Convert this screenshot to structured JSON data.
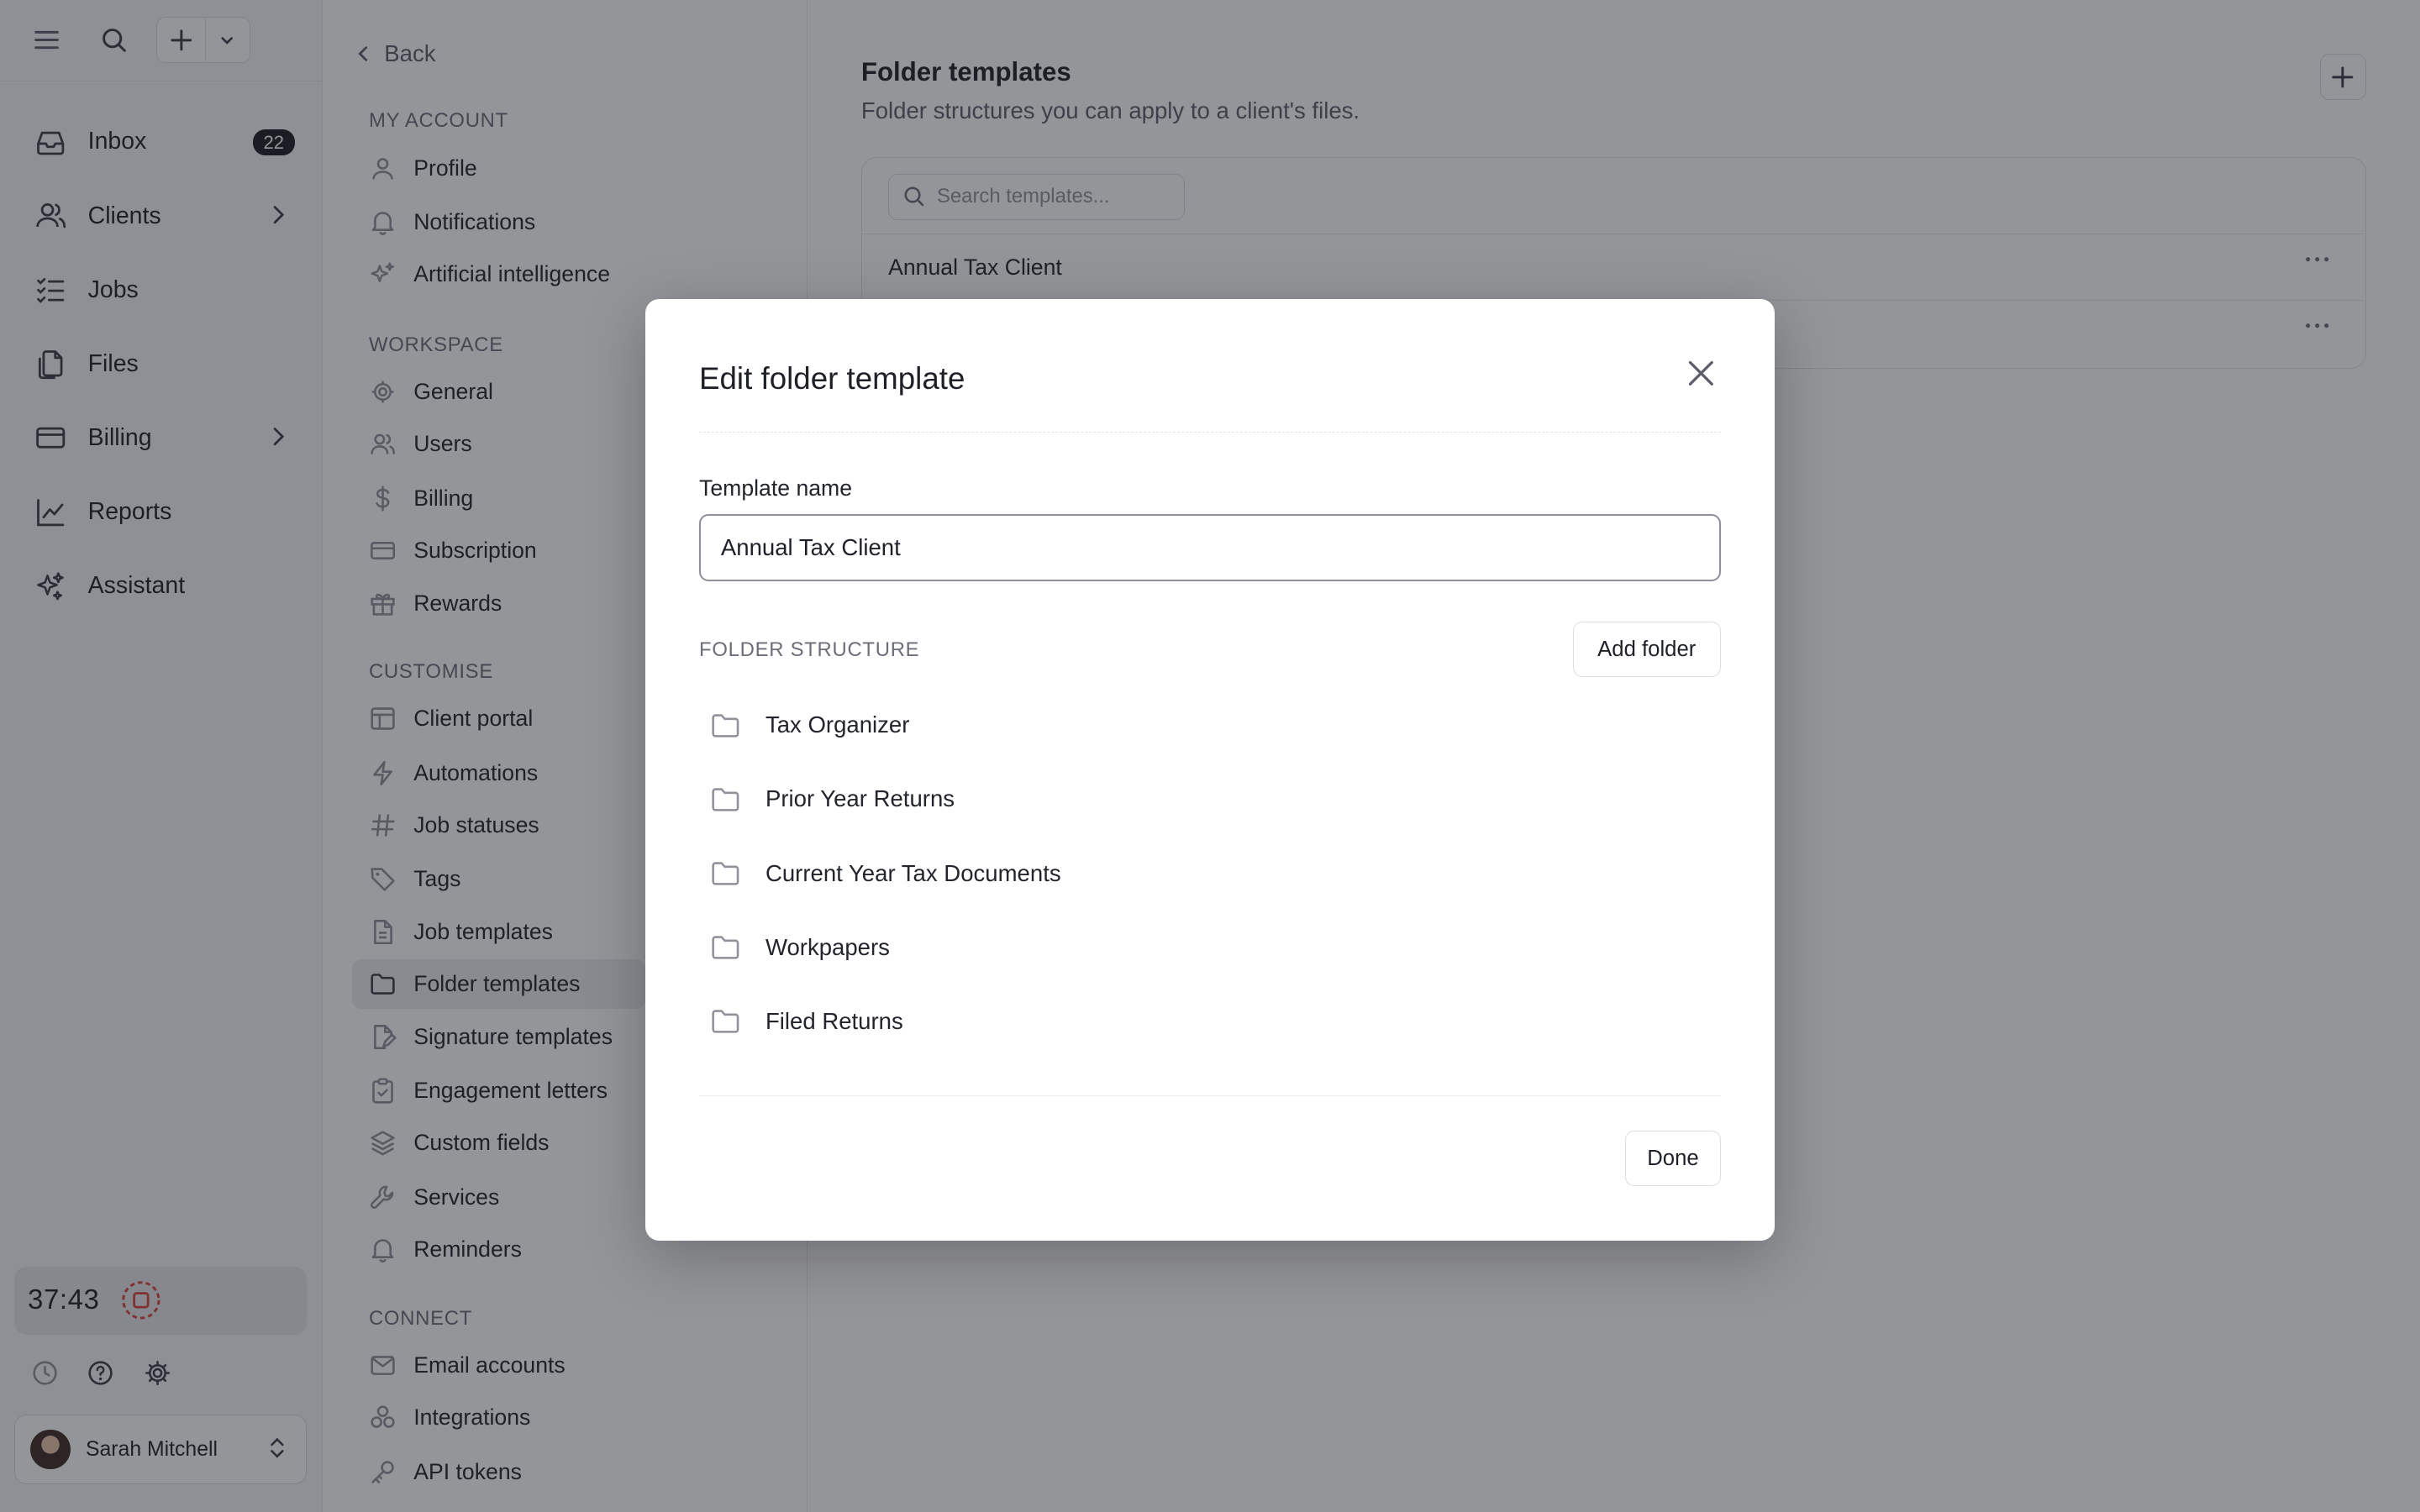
{
  "nav": {
    "items": [
      {
        "label": "Inbox",
        "icon": "inbox-icon",
        "badge": "22"
      },
      {
        "label": "Clients",
        "icon": "users-icon"
      },
      {
        "label": "Jobs",
        "icon": "list-check-icon"
      },
      {
        "label": "Files",
        "icon": "files-icon"
      },
      {
        "label": "Billing",
        "icon": "credit-card-icon"
      },
      {
        "label": "Reports",
        "icon": "chart-line-icon"
      },
      {
        "label": "Assistant",
        "icon": "sparkles-icon"
      }
    ],
    "timer": "37:43",
    "user_name": "Sarah Mitchell"
  },
  "settings": {
    "back_label": "Back",
    "sections": {
      "my_account": "MY ACCOUNT",
      "workspace": "WORKSPACE",
      "customise": "CUSTOMISE",
      "connect": "CONNECT"
    },
    "items": {
      "profile": "Profile",
      "notifications": "Notifications",
      "ai": "Artificial intelligence",
      "general": "General",
      "users": "Users",
      "billing": "Billing",
      "subscription": "Subscription",
      "rewards": "Rewards",
      "client_portal": "Client portal",
      "automations": "Automations",
      "job_statuses": "Job statuses",
      "tags": "Tags",
      "job_templates": "Job templates",
      "folder_templates": "Folder templates",
      "signature_templates": "Signature templates",
      "engagement_letters": "Engagement letters",
      "custom_fields": "Custom fields",
      "services": "Services",
      "reminders": "Reminders",
      "email_accounts": "Email accounts",
      "integrations": "Integrations",
      "api_tokens": "API tokens"
    }
  },
  "main": {
    "title": "Folder templates",
    "subtitle": "Folder structures you can apply to a client's files.",
    "search_placeholder": "Search templates...",
    "rows": [
      "Annual Tax Client",
      ""
    ]
  },
  "modal": {
    "title": "Edit folder template",
    "name_label": "Template name",
    "name_value": "Annual Tax Client",
    "structure_label": "FOLDER STRUCTURE",
    "add_folder": "Add folder",
    "folders": [
      "Tax Organizer",
      "Prior Year Returns",
      "Current Year Tax Documents",
      "Workpapers",
      "Filed Returns"
    ],
    "done": "Done"
  },
  "colors": {
    "overlay": "#1c1e26",
    "badge": "#1c1d22",
    "record": "#d9443a"
  }
}
